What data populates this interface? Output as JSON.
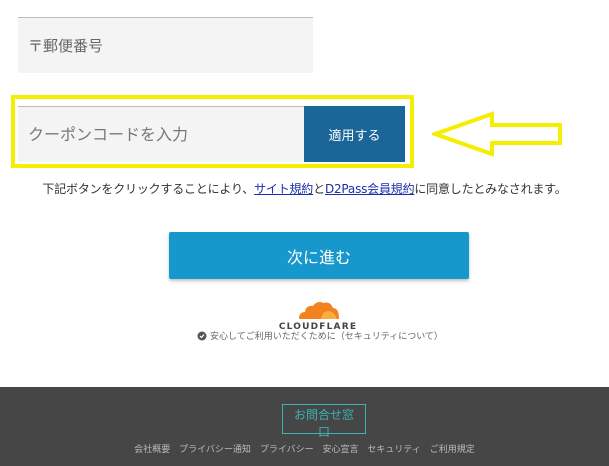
{
  "postal": {
    "label": "〒郵便番号"
  },
  "coupon": {
    "placeholder": "クーポンコードを入力",
    "apply_label": "適用する"
  },
  "consent": {
    "prefix": "下記ボタンをクリックすることにより、",
    "site_terms": "サイト規約",
    "and": "と",
    "member_terms": "D2Pass会員規約",
    "suffix": "に同意したとみなされます。"
  },
  "next_button": "次に進む",
  "cloudflare": {
    "brand": "CLOUDFLARE",
    "security_text": "安心してご利用いただくために（セキュリティについて）"
  },
  "footer": {
    "contact_label": "お問合せ窓口",
    "links": [
      "会社概要",
      "プライバシー通知",
      "プライバシー",
      "安心宣言",
      "セキュリティ",
      "ご利用規定"
    ]
  },
  "colors": {
    "highlight": "#f5ee00",
    "apply": "#1a6698",
    "next": "#1798cc",
    "footer": "#464646",
    "accent": "#3bb3b3"
  }
}
